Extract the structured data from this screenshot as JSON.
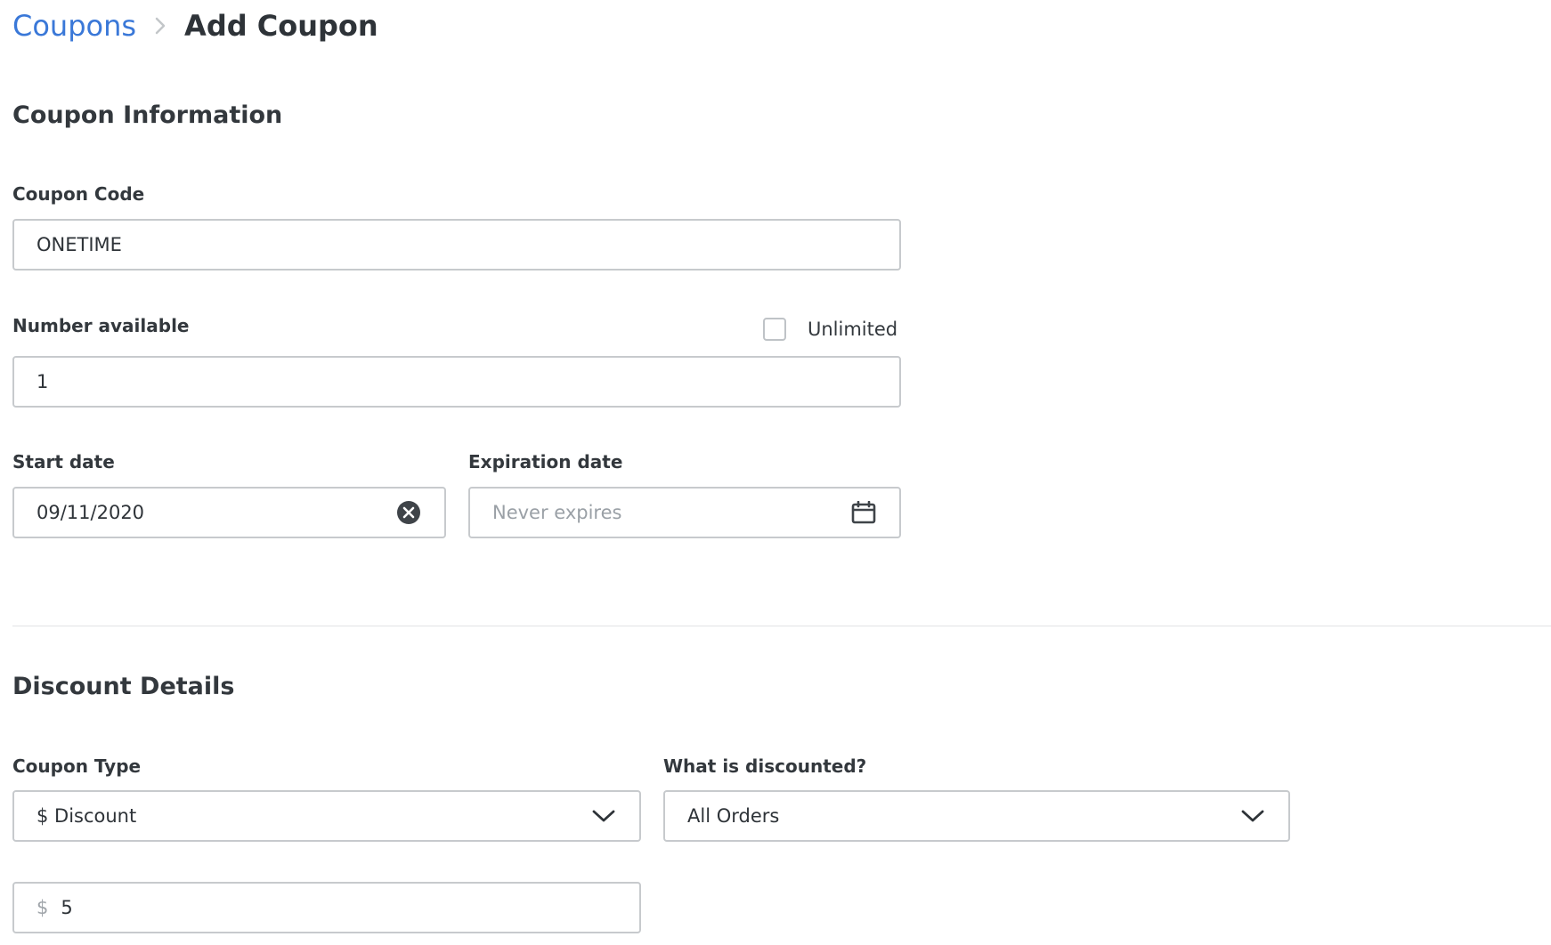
{
  "breadcrumb": {
    "parent": "Coupons",
    "current": "Add Coupon"
  },
  "coupon_info": {
    "title": "Coupon Information",
    "code": {
      "label": "Coupon Code",
      "value": "ONETIME"
    },
    "number_available": {
      "label": "Number available",
      "value": "1",
      "unlimited_label": "Unlimited",
      "unlimited_checked": false
    },
    "start_date": {
      "label": "Start date",
      "value": "09/11/2020"
    },
    "expiration_date": {
      "label": "Expiration date",
      "placeholder": "Never expires"
    }
  },
  "discount_details": {
    "title": "Discount Details",
    "coupon_type": {
      "label": "Coupon Type",
      "selected": "$ Discount"
    },
    "what_discounted": {
      "label": "What is discounted?",
      "selected": "All Orders"
    },
    "amount": {
      "prefix": "$",
      "value": "5"
    }
  },
  "colors": {
    "link": "#3a78d8",
    "text": "#2e3338",
    "border": "#c7cacd",
    "placeholder": "#9aa0a6"
  },
  "icons": {
    "breadcrumb_separator": "chevron-right-icon",
    "clear": "clear-circle-icon",
    "calendar": "calendar-icon",
    "dropdown": "chevron-down-icon"
  }
}
